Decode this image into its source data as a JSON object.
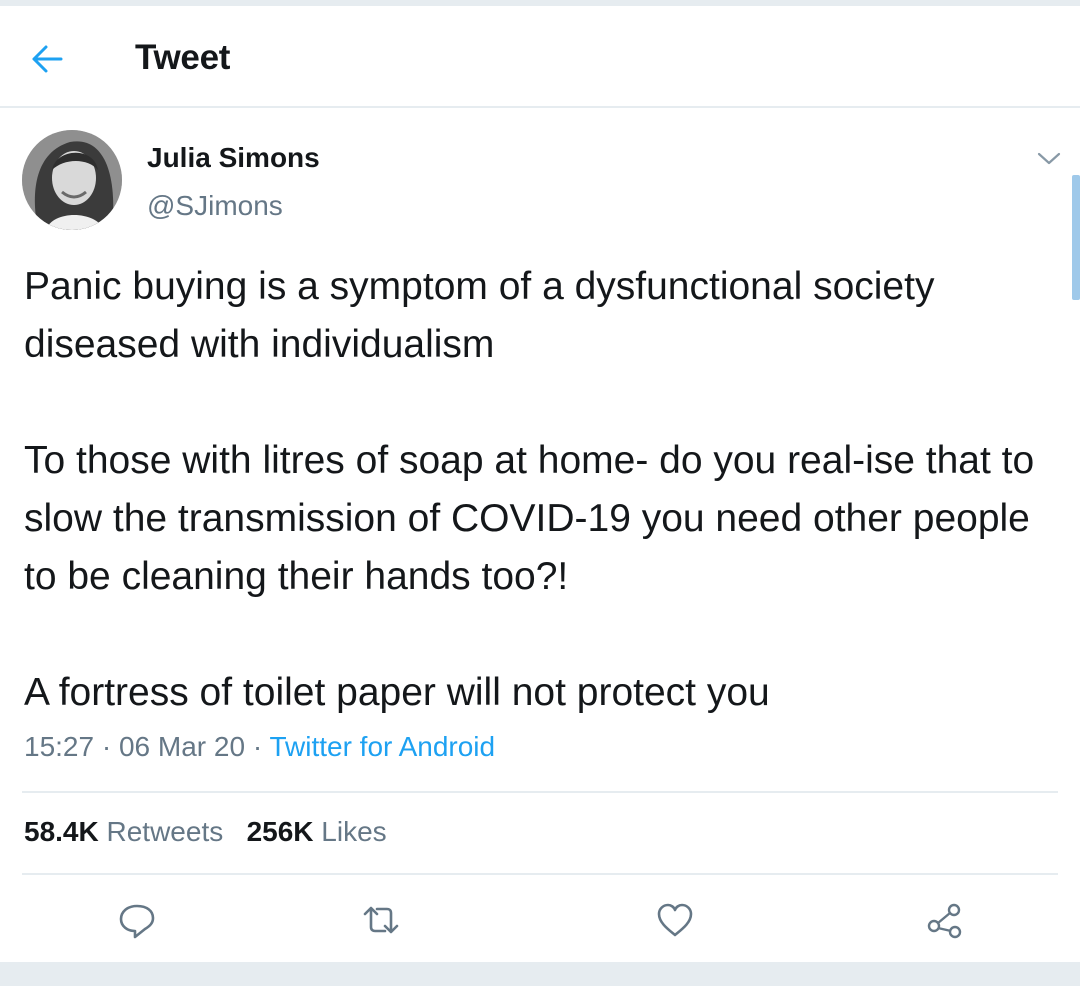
{
  "header": {
    "title": "Tweet",
    "back_icon": "arrow-left-icon"
  },
  "author": {
    "name": "Julia Simons",
    "handle": "@SJimons"
  },
  "tweet": {
    "paragraphs": [
      "Panic buying is a symptom of a dysfunctional society diseased with individualism",
      "To those with litres of soap at home- do you real-ise that to slow the transmission of COVID-19 you need other people to be cleaning their hands too?!",
      "A fortress of toilet paper will not protect you"
    ]
  },
  "meta": {
    "time": "15:27",
    "date": "06 Mar 20",
    "separator": "·",
    "source": "Twitter for Android"
  },
  "stats": {
    "retweets_count": "58.4K",
    "retweets_label": "Retweets",
    "likes_count": "256K",
    "likes_label": "Likes"
  },
  "actions": {
    "reply_icon": "reply-icon",
    "retweet_icon": "retweet-icon",
    "like_icon": "heart-icon",
    "share_icon": "share-icon"
  },
  "colors": {
    "accent": "#1da1f2",
    "secondary_text": "#657786",
    "divider": "#e6ecf0"
  }
}
